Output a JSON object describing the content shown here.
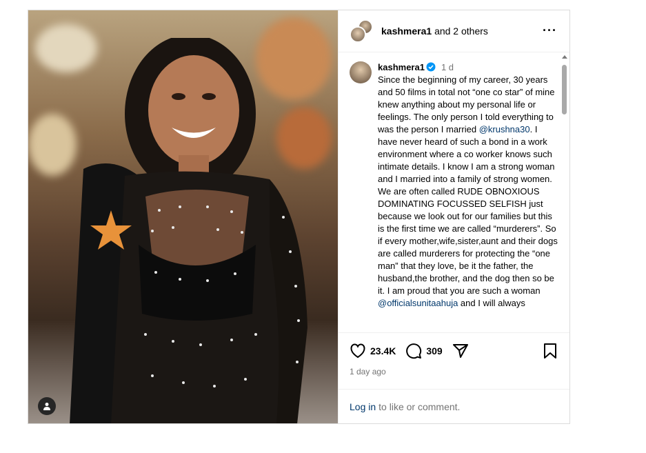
{
  "header": {
    "username": "kashmera1",
    "others_text": "and 2 others",
    "more_icon": "more-horizontal-icon"
  },
  "caption": {
    "username": "kashmera1",
    "time": "1 d",
    "text_part1": "Since the beginning of my career, 30 years and 50 films in total not “one co star” of mine knew anything about my personal life or feelings. The only person I told everything to was the person I married ",
    "mention1": "@krushna30",
    "text_part2": ". I have never heard of such a bond in a work environment where a co worker knows such intimate details. I know I am a strong woman and I married into a family of strong women. We are often called RUDE OBNOXIOUS DOMINATING FOCUSSED SELFISH just because we look out for our families but this is the first time we are called “murderers”. So if every mother,wife,sister,aunt and their dogs are called murderers for protecting the “one man” that they love, be it the father, the husband,the brother, and the dog then so be it. I am proud that you are such a woman ",
    "mention2": "@officialsunitaahuja",
    "text_part3": " and I will always"
  },
  "actions": {
    "likes": "23.4K",
    "comments": "309",
    "posted_ago": "1 day ago"
  },
  "footer": {
    "login_link": "Log in",
    "login_text": "to like or comment."
  },
  "colors": {
    "link": "#00376b",
    "verified": "#0095f6",
    "muted": "#737373"
  }
}
